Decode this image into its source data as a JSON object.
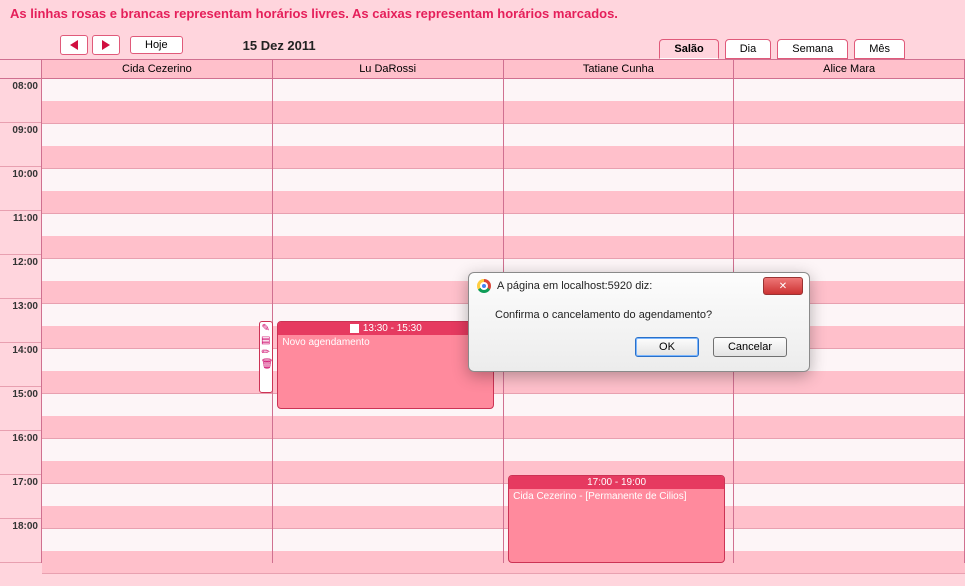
{
  "instruction": "As linhas rosas e brancas representam horários livres. As caixas representam horários marcados.",
  "toolbar": {
    "today": "Hoje",
    "date": "15 Dez 2011"
  },
  "tabs": {
    "salao": "Salão",
    "dia": "Dia",
    "semana": "Semana",
    "mes": "Mês"
  },
  "people": [
    "Cida Cezerino",
    "Lu DaRossi",
    "Tatiane Cunha",
    "Alice Mara"
  ],
  "hours": [
    "08:00",
    "09:00",
    "10:00",
    "11:00",
    "12:00",
    "13:00",
    "14:00",
    "15:00",
    "16:00",
    "17:00",
    "18:00"
  ],
  "appointments": {
    "a1": {
      "time": "13:30 - 15:30",
      "title": "Novo agendamento"
    },
    "a2": {
      "time": "17:00 - 19:00",
      "title": "Cida Cezerino - [Permanente de Cilios]"
    }
  },
  "dialog": {
    "title": "A página em localhost:5920 diz:",
    "message": "Confirma o cancelamento do agendamento?",
    "ok": "OK",
    "cancel": "Cancelar"
  }
}
